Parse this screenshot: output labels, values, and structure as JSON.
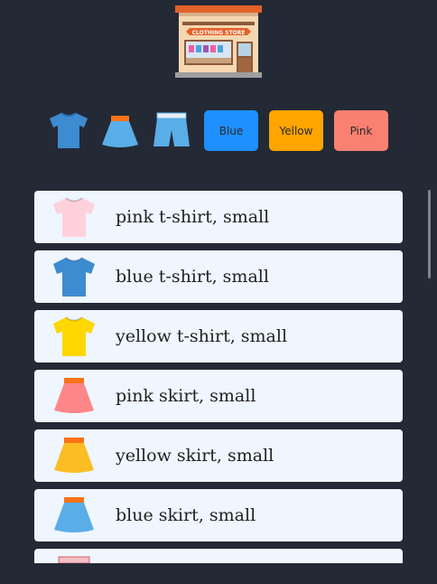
{
  "store": {
    "sign_text": "CLOTHING STORE",
    "icon": "clothing-store-icon"
  },
  "filters": {
    "category_icons": [
      "t-shirt-icon",
      "skirt-icon",
      "shorts-icon"
    ],
    "colors": [
      {
        "label": "Blue",
        "color": "#1e90ff"
      },
      {
        "label": "Yellow",
        "color": "#ffa500"
      },
      {
        "label": "Pink",
        "color": "#fa8072"
      }
    ]
  },
  "items": [
    {
      "label": "pink t-shirt, small",
      "type": "t-shirt",
      "color": "#ffd1dc"
    },
    {
      "label": "blue t-shirt, small",
      "type": "t-shirt",
      "color": "#3d8bd0"
    },
    {
      "label": "yellow t-shirt, small",
      "type": "t-shirt",
      "color": "#ffd700"
    },
    {
      "label": "pink skirt, small",
      "type": "skirt",
      "color": "#fd8689"
    },
    {
      "label": "yellow skirt, small",
      "type": "skirt",
      "color": "#fbbd23"
    },
    {
      "label": "blue skirt, small",
      "type": "skirt",
      "color": "#5aaee8"
    },
    {
      "label": "",
      "type": "shorts",
      "color": "#f6a5a8"
    }
  ]
}
